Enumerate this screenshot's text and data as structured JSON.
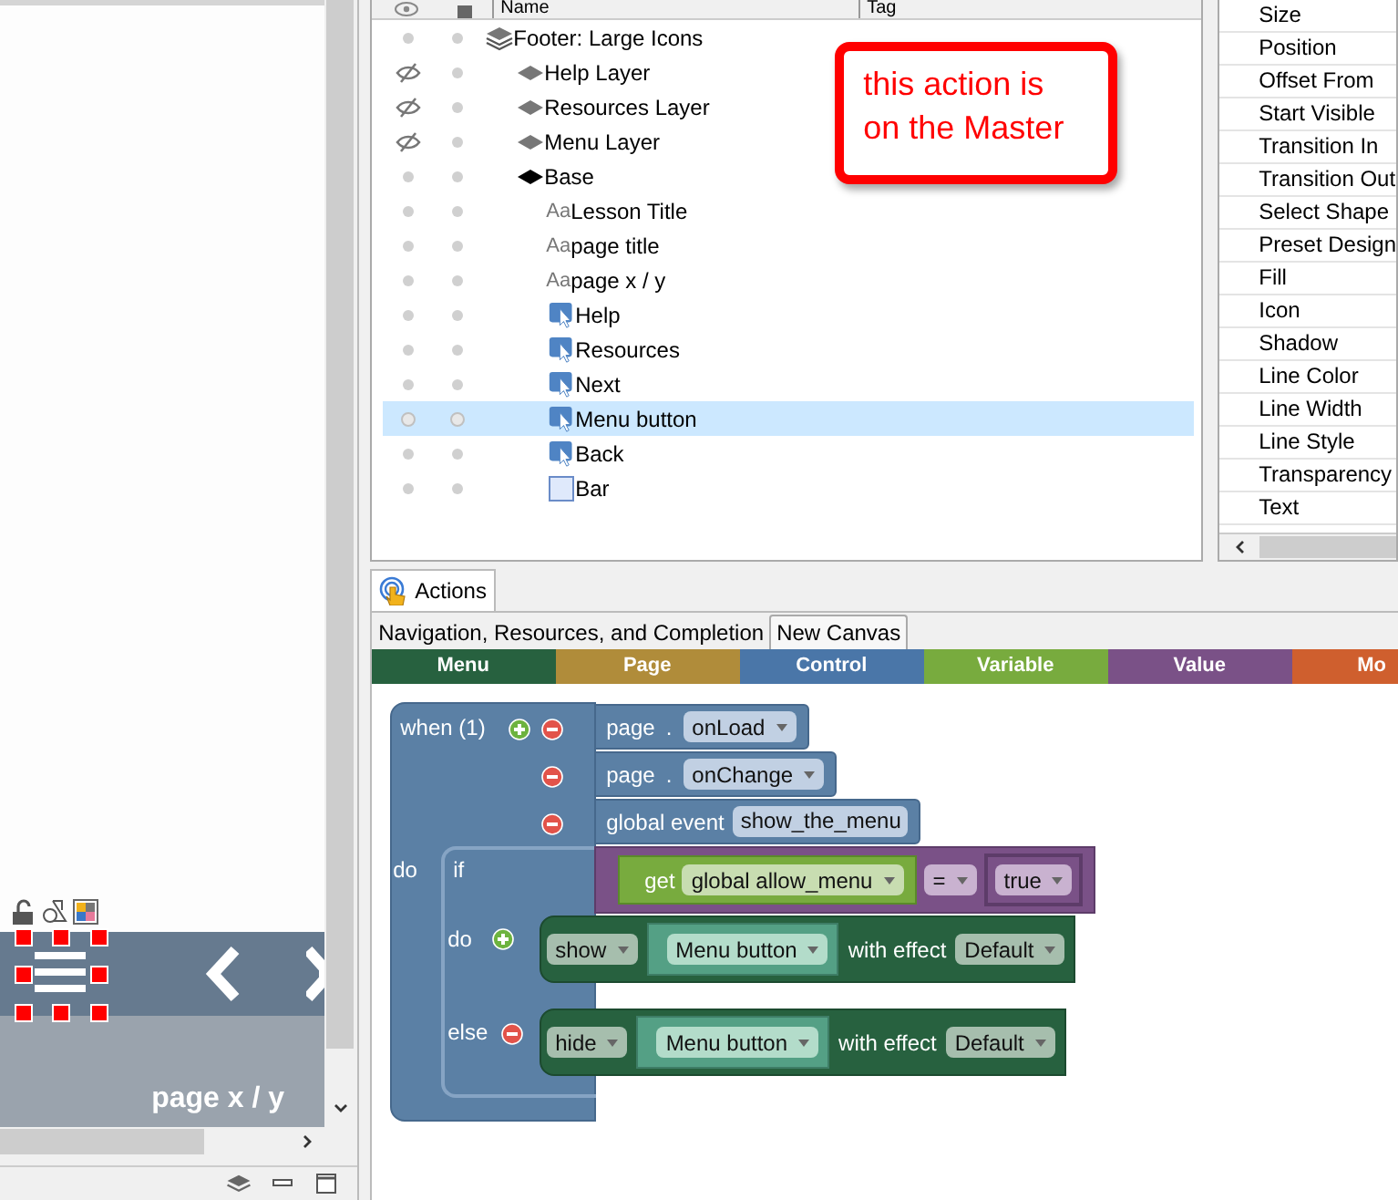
{
  "canvas": {
    "page_label": "page x / y"
  },
  "layers": {
    "columns": [
      "Name",
      "Tag"
    ],
    "items": [
      {
        "kind": "group",
        "name": "Footer: Large Icons",
        "hidden": false,
        "selected": false,
        "children": [
          {
            "kind": "layer",
            "name": "Help Layer",
            "hidden": true,
            "current": false,
            "selected": false
          },
          {
            "kind": "layer",
            "name": "Resources Layer",
            "hidden": true,
            "current": false,
            "selected": false
          },
          {
            "kind": "layer",
            "name": "Menu Layer",
            "hidden": true,
            "current": false,
            "selected": false
          },
          {
            "kind": "layer",
            "name": "Base",
            "hidden": false,
            "current": true,
            "selected": false,
            "children": [
              {
                "kind": "text",
                "type_label": "Aa",
                "name": "Lesson Title",
                "hidden": false,
                "selected": false
              },
              {
                "kind": "text",
                "type_label": "Aa",
                "name": "page title",
                "hidden": false,
                "selected": false
              },
              {
                "kind": "text",
                "type_label": "Aa",
                "name": "page x / y",
                "hidden": false,
                "selected": false
              },
              {
                "kind": "button",
                "name": "Help",
                "hidden": false,
                "selected": false
              },
              {
                "kind": "button",
                "name": "Resources",
                "hidden": false,
                "selected": false
              },
              {
                "kind": "button",
                "name": "Next",
                "hidden": false,
                "selected": false
              },
              {
                "kind": "button",
                "name": "Menu button",
                "hidden": false,
                "selected": true
              },
              {
                "kind": "button",
                "name": "Back",
                "hidden": false,
                "selected": false
              },
              {
                "kind": "shape",
                "name": "Bar",
                "hidden": false,
                "selected": false
              }
            ]
          }
        ]
      }
    ],
    "note": "this action is\non the Master"
  },
  "properties": {
    "items": [
      "Size",
      "Position",
      "Offset From",
      "Start Visible",
      "Transition In",
      "Transition Out",
      "Select Shape",
      "Preset Design",
      "Fill",
      "Icon",
      "Shadow",
      "Line Color",
      "Line Width",
      "Line Style",
      "Transparency",
      "Text"
    ]
  },
  "actions": {
    "tab": "Actions",
    "canvas_tabs": [
      {
        "label": "Navigation, Resources, and Completion",
        "selected": true
      },
      {
        "label": "New Canvas",
        "selected": false
      }
    ],
    "categories": [
      {
        "label": "Menu",
        "color": "#27613f"
      },
      {
        "label": "Page",
        "color": "#b08c3a"
      },
      {
        "label": "Control",
        "color": "#4a76a8"
      },
      {
        "label": "Variable",
        "color": "#78ab3e"
      },
      {
        "label": "Value",
        "color": "#7a5187"
      },
      {
        "label": "Mo",
        "color": "#cf5f2e"
      }
    ],
    "script": {
      "when_label": "when (1)",
      "triggers": [
        {
          "kind": "object-event",
          "object": "page",
          "separator": ".",
          "event": "onLoad"
        },
        {
          "kind": "object-event",
          "object": "page",
          "separator": ".",
          "event": "onChange"
        },
        {
          "kind": "global-event",
          "label": "global event",
          "event": "show_the_menu"
        }
      ],
      "do_label": "do",
      "if_label": "if",
      "condition": {
        "getter": "get",
        "variable": "global allow_menu",
        "operator": "=",
        "value": "true"
      },
      "then_label": "do",
      "then_action": {
        "verb": "show",
        "target": "Menu button",
        "effect_label": "with effect",
        "effect": "Default"
      },
      "else_label": "else",
      "else_action": {
        "verb": "hide",
        "target": "Menu button",
        "effect_label": "with effect",
        "effect": "Default"
      }
    }
  }
}
